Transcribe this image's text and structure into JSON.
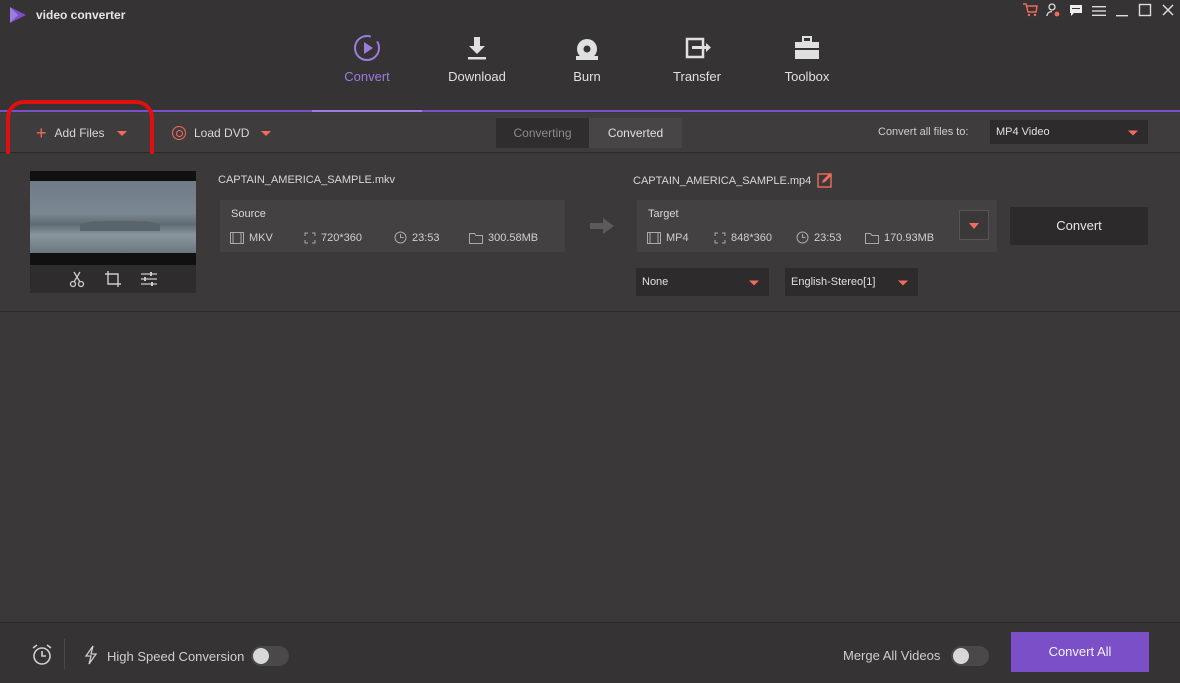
{
  "app": {
    "title": "video converter"
  },
  "window_controls": [
    "cart-icon",
    "user-icon",
    "chat-icon",
    "menu-icon",
    "minimize-icon",
    "maximize-icon",
    "close-icon"
  ],
  "nav": {
    "items": [
      {
        "label": "Convert",
        "icon": "convert-icon",
        "active": true
      },
      {
        "label": "Download",
        "icon": "download-icon",
        "active": false
      },
      {
        "label": "Burn",
        "icon": "burn-icon",
        "active": false
      },
      {
        "label": "Transfer",
        "icon": "transfer-icon",
        "active": false
      },
      {
        "label": "Toolbox",
        "icon": "toolbox-icon",
        "active": false
      }
    ]
  },
  "toolbar": {
    "add_files": "Add Files",
    "load_dvd": "Load DVD",
    "tabs": [
      {
        "label": "Converting",
        "active": false
      },
      {
        "label": "Converted",
        "active": true
      }
    ],
    "convert_all_label": "Convert all files to:",
    "convert_all_value": "MP4 Video"
  },
  "file": {
    "source_name": "CAPTAIN_AMERICA_SAMPLE.mkv",
    "target_name": "CAPTAIN_AMERICA_SAMPLE.mp4",
    "source": {
      "header": "Source",
      "format": "MKV",
      "resolution": "720*360",
      "duration": "23:53",
      "size": "300.58MB"
    },
    "target": {
      "header": "Target",
      "format": "MP4",
      "resolution": "848*360",
      "duration": "23:53",
      "size": "170.93MB"
    },
    "subtitle": "None",
    "audio": "English-Stereo[1]",
    "convert_label": "Convert"
  },
  "footer": {
    "high_speed": "High Speed Conversion",
    "merge": "Merge All Videos",
    "convert_all": "Convert All"
  },
  "colors": {
    "accent": "#7b4fc8",
    "accent_light": "#9e7be0",
    "orange": "#f26b5e",
    "highlight_red": "#e01010"
  }
}
